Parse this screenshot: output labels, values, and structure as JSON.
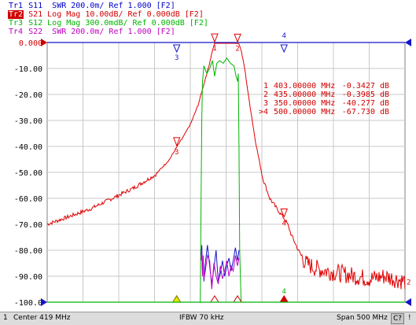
{
  "traces": [
    {
      "tag": "Tr1",
      "text": "S11  SWR 200.0m/ Ref 1.000 [F2]",
      "color": "#0000c8",
      "active": false
    },
    {
      "tag": "Tr2",
      "text": "S21 Log Mag 10.00dB/ Ref 0.000dB [F2]",
      "color": "#d00000",
      "active": true
    },
    {
      "tag": "Tr3",
      "text": "S12 Log Mag 300.0mdB/ Ref 0.000dB [F2]",
      "color": "#00b400",
      "active": false
    },
    {
      "tag": "Tr4",
      "text": "S22  SWR 200.0m/ Ref 1.000 [F2]",
      "color": "#c000c0",
      "active": false
    }
  ],
  "marker_table": [
    {
      "num": "1",
      "freq": "403.00000 MHz",
      "value": "-0.3427 dB"
    },
    {
      "num": "2",
      "freq": "435.00000 MHz",
      "value": "-0.3985 dB"
    },
    {
      "num": "3",
      "freq": "350.00000 MHz",
      "value": "-40.277 dB"
    },
    {
      "num": ">4",
      "freq": "500.00000 MHz",
      "value": "-67.730 dB"
    }
  ],
  "status": {
    "channel": "1",
    "center": "Center 419 MHz",
    "ifbw": "IFBW 70 kHz",
    "span": "Span 500 MHz",
    "cal": "C?",
    "warn": "!"
  },
  "chart_data": {
    "type": "line",
    "xlim": [
      169,
      669
    ],
    "ylim": [
      -100,
      0
    ],
    "yticks": [
      0,
      -10,
      -20,
      -30,
      -40,
      -50,
      -60,
      -70,
      -80,
      -90,
      -100
    ],
    "ytick_labels": [
      "0.000",
      "-10.00",
      "-20.00",
      "-30.00",
      "-40.00",
      "-50.00",
      "-60.00",
      "-70.00",
      "-80.00",
      "-90.00",
      "-100.0"
    ],
    "grid": true,
    "ref_level_label": "2",
    "series": [
      {
        "name": "S21",
        "color": "#e00000",
        "x": [
          169,
          200,
          230,
          260,
          290,
          320,
          340,
          350,
          360,
          370,
          380,
          390,
          395,
          400,
          403,
          407,
          412,
          420,
          430,
          435,
          437,
          440,
          445,
          450,
          460,
          470,
          480,
          490,
          500,
          505,
          510,
          520,
          530,
          545,
          560,
          580,
          600,
          620,
          640,
          669
        ],
        "y": [
          -70,
          -67,
          -64,
          -60,
          -56,
          -51,
          -45,
          -40.3,
          -36,
          -31,
          -24,
          -14,
          -9,
          -3,
          -0.34,
          -0.3,
          -0.3,
          -0.3,
          -0.3,
          -0.4,
          -0.5,
          -3,
          -10,
          -20,
          -38,
          -52,
          -60,
          -64,
          -67.7,
          -70,
          -74,
          -80,
          -85,
          -87,
          -88,
          -89,
          -90,
          -91,
          -90,
          -92
        ]
      },
      {
        "name": "S12",
        "color": "#00b400",
        "x": [
          169,
          383,
          384,
          385,
          386,
          388,
          392,
          396,
          400,
          403,
          406,
          410,
          415,
          420,
          425,
          430,
          433,
          435,
          436,
          437,
          438,
          440,
          669
        ],
        "y": [
          -100,
          -100,
          -60,
          -30,
          -15,
          -9,
          -12,
          -10,
          -7,
          -13,
          -8,
          -7,
          -8,
          -6,
          -8,
          -9,
          -13,
          -15,
          -12,
          -40,
          -80,
          -100,
          -100
        ]
      },
      {
        "name": "S11",
        "color": "#1414c8",
        "x": [
          384,
          385,
          386,
          387,
          388,
          390,
          393,
          396,
          399,
          402,
          405,
          408,
          411,
          414,
          417,
          420,
          423,
          426,
          429,
          432,
          435,
          437
        ],
        "y": [
          -82,
          -78,
          -88,
          -84,
          -92,
          -85,
          -78,
          -86,
          -93,
          -87,
          -80,
          -92,
          -89,
          -84,
          -90,
          -86,
          -83,
          -88,
          -84,
          -79,
          -84,
          -80
        ]
      },
      {
        "name": "S22",
        "color": "#c000c0",
        "x": [
          384,
          385,
          386,
          387,
          388,
          390,
          393,
          396,
          399,
          402,
          405,
          408,
          411,
          414,
          417,
          420,
          423,
          426,
          429,
          432,
          435,
          437
        ],
        "y": [
          -84,
          -80,
          -90,
          -82,
          -91,
          -88,
          -82,
          -84,
          -95,
          -85,
          -90,
          -93,
          -86,
          -91,
          -88,
          -84,
          -90,
          -86,
          -88,
          -82,
          -86,
          -83
        ]
      }
    ],
    "markers": [
      {
        "label": "1",
        "x": 403,
        "y": -0.3427,
        "color": "#e00000"
      },
      {
        "label": "2",
        "x": 435,
        "y": -0.3985,
        "color": "#e00000"
      },
      {
        "label": "3",
        "x": 350,
        "y": -40.277,
        "color": "#e00000"
      },
      {
        "label": "4",
        "x": 500,
        "y": -67.73,
        "color": "#e00000"
      }
    ]
  }
}
